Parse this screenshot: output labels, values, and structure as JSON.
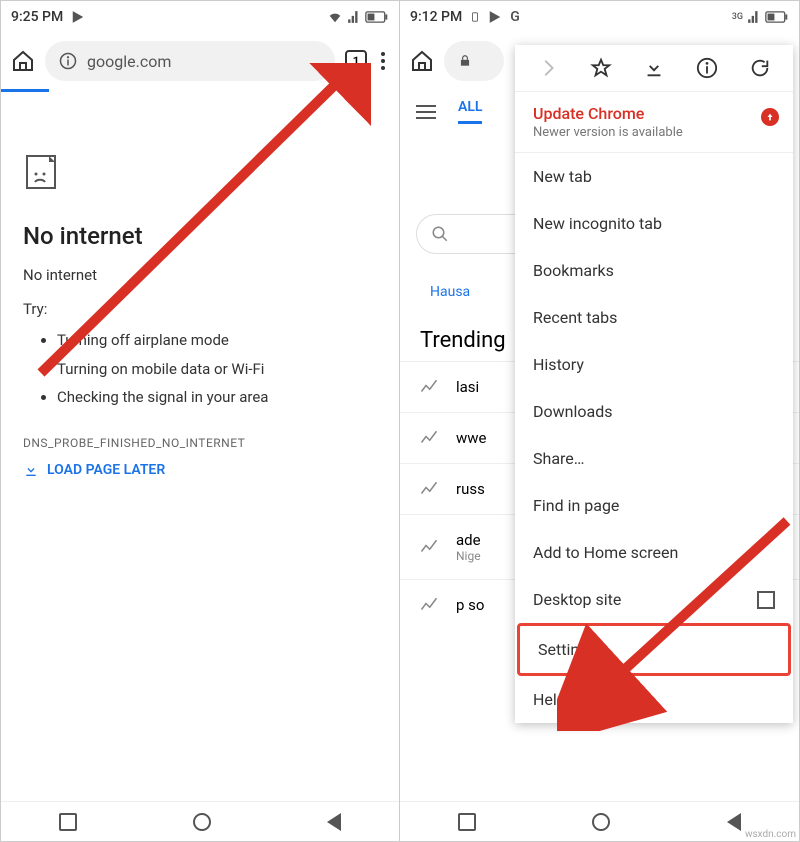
{
  "phone1": {
    "status_time": "9:25 PM",
    "url": "google.com",
    "tab_count": "1",
    "heading": "No internet",
    "subtext": "No internet",
    "try_label": "Try:",
    "tips": [
      "Turning off airplane mode",
      "Turning on mobile data or Wi-Fi",
      "Checking the signal in your area"
    ],
    "error_code": "DNS_PROBE_FINISHED_NO_INTERNET",
    "load_later": "LOAD PAGE LATER"
  },
  "phone2": {
    "status_time": "9:12 PM",
    "tabs_all": "ALL",
    "lang1": "Hausa",
    "trending_label": "Trending",
    "trending": [
      "lasi",
      "wwe",
      "russ",
      "ade",
      "p so"
    ],
    "trending_sub": "Nige",
    "menu": {
      "update_title": "Update Chrome",
      "update_sub": "Newer version is available",
      "items": {
        "new_tab": "New tab",
        "incognito": "New incognito tab",
        "bookmarks": "Bookmarks",
        "recent": "Recent tabs",
        "history": "History",
        "downloads": "Downloads",
        "share": "Share…",
        "find": "Find in page",
        "homescreen": "Add to Home screen",
        "desktop": "Desktop site",
        "settings": "Settings",
        "help": "Help & feedback"
      }
    }
  },
  "watermark": "wsxdn.com"
}
